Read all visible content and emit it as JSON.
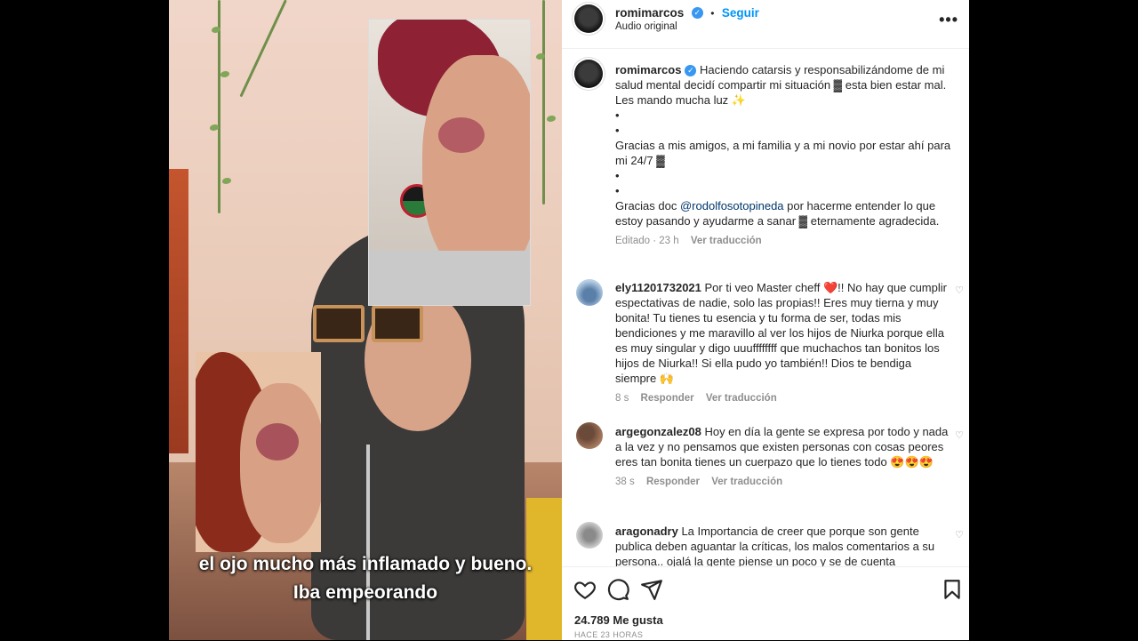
{
  "media": {
    "caption_line1": "el ojo mucho más inflamado y bueno.",
    "caption_line2": "Iba empeorando"
  },
  "header": {
    "username": "romimarcos",
    "follow_label": "Seguir",
    "separator": "•",
    "subtitle": "Audio original",
    "more_icon": "more-horizontal-icon"
  },
  "post": {
    "username": "romimarcos",
    "caption_p1": "Haciendo catarsis y responsabilizándome de mi salud mental decidí compartir mi situación ▓ esta bien estar mal. Les mando mucha luz ✨",
    "bullet": "•",
    "caption_p2": "Gracias a mis amigos, a mi familia y a mi novio por estar ahí para mi 24/7 ▓",
    "caption_p3_pre": "Gracias doc ",
    "mention": "@rodolfosotopineda",
    "caption_p3_post": " por hacerme entender lo que estoy pasando y ayudarme a sanar ▓ eternamente agradecida.",
    "edited": "Editado · 23 h",
    "translate": "Ver traducción"
  },
  "comments": [
    {
      "username": "ely11201732021",
      "text": "Por ti veo Master cheff ❤️!! No hay que cumplir espectativas de nadie, solo las propias!! Eres muy tierna y muy bonita! Tu tienes tu esencia y tu forma de ser, todas mis bendiciones y me maravillo al ver los hijos de Niurka porque ella es muy singular y digo uuuffffffff que muchachos tan bonitos los hijos de Niurka!! Si ella pudo yo también!! Dios te bendiga siempre 🙌",
      "time": "8 s",
      "reply": "Responder",
      "translate": "Ver traducción"
    },
    {
      "username": "argegonzalez08",
      "text": "Hoy en día la gente se expresa por todo y nada a la vez y no pensamos que existen personas con cosas peores eres tan bonita tienes un cuerpazo que lo tienes todo 😍😍😍",
      "time": "38 s",
      "reply": "Responder",
      "translate": "Ver traducción"
    },
    {
      "username": "aragonadry",
      "text": "La Importancia de creer que porque son gente publica deben aguantar la críticas, los malos comentarios a su persona.. ojalá la gente piense un poco y se de cuenta",
      "time": "",
      "reply": "",
      "translate": ""
    }
  ],
  "footer": {
    "likes": "24.789 Me gusta",
    "ago": "HACE 23 HORAS",
    "icons": [
      "heart-icon",
      "comment-icon",
      "share-icon",
      "bookmark-icon"
    ]
  },
  "colors": {
    "link": "#0095f6",
    "verified": "#3897f0",
    "muted": "#8e8e8e"
  }
}
